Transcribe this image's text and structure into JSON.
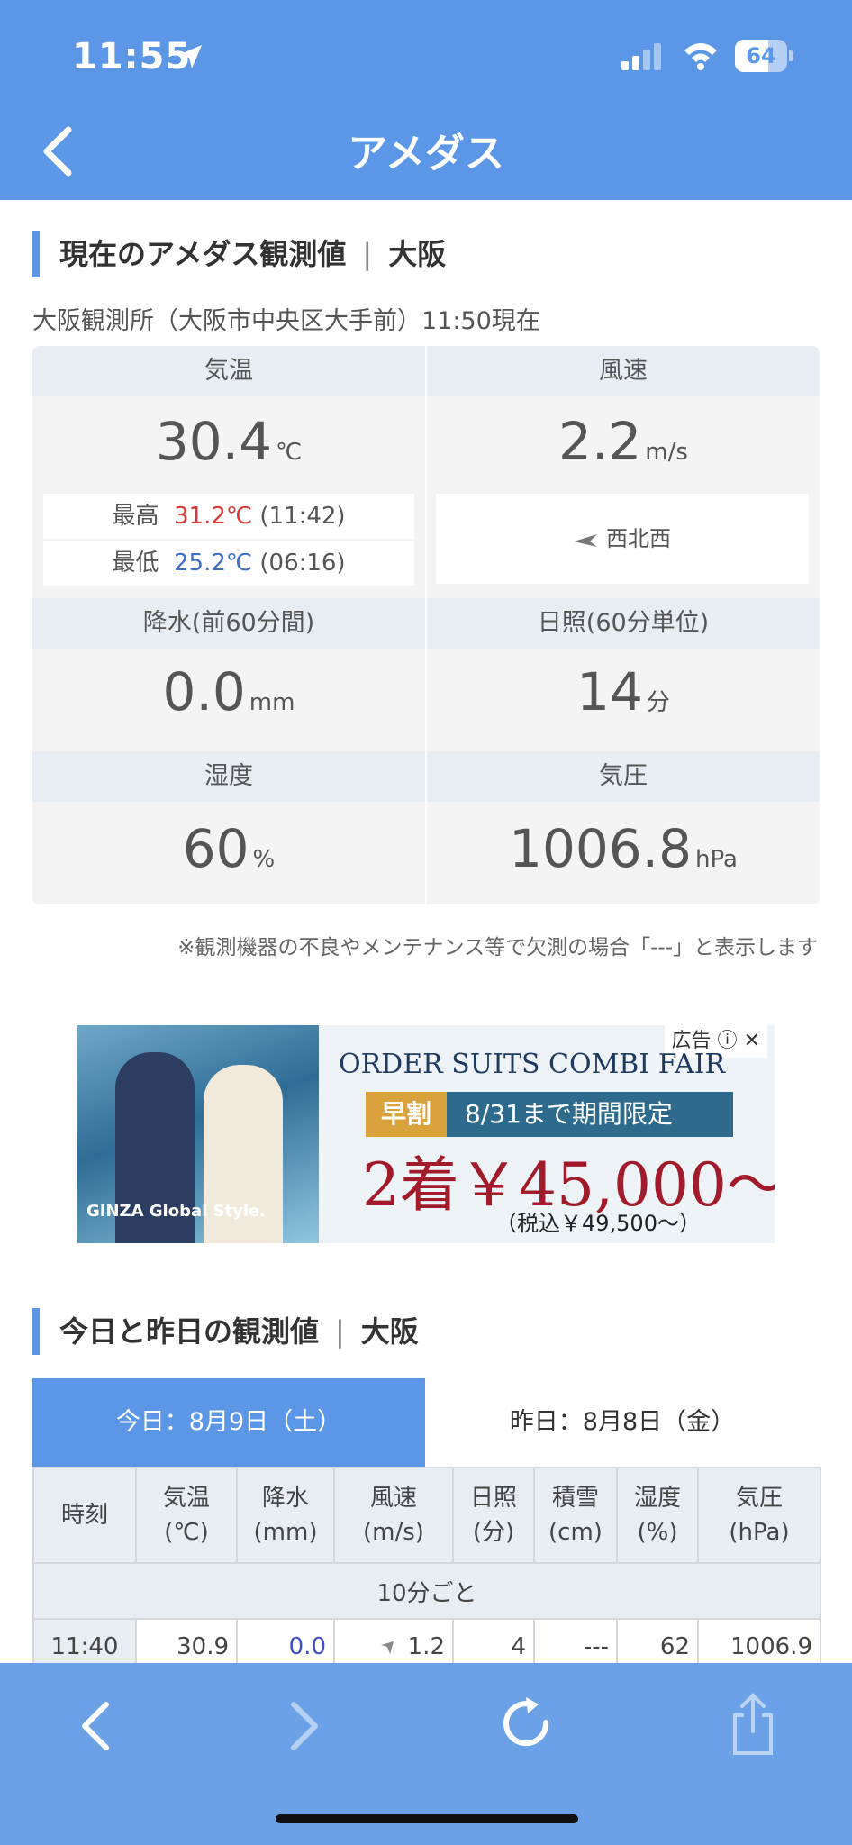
{
  "status_bar": {
    "time": "11:55",
    "battery": "64",
    "battery_level": 0.64
  },
  "header": {
    "title": "アメダス"
  },
  "current": {
    "heading": "現在のアメダス観測値",
    "heading_sep": "|",
    "heading_location": "大阪",
    "station": "大阪観測所（大阪市中央区大手前）11:50現在",
    "temperature": {
      "label": "気温",
      "value": "30.4",
      "unit": "℃",
      "max_label": "最高",
      "max_value": "31.2℃",
      "max_time": "(11:42)",
      "min_label": "最低",
      "min_value": "25.2℃",
      "min_time": "(06:16)"
    },
    "wind": {
      "label": "風速",
      "value": "2.2",
      "unit": "m/s",
      "direction": "西北西"
    },
    "precip": {
      "label": "降水(前60分間)",
      "value": "0.0",
      "unit": "mm"
    },
    "sunshine": {
      "label": "日照(60分単位)",
      "value": "14",
      "unit": "分"
    },
    "humidity": {
      "label": "湿度",
      "value": "60",
      "unit": "%"
    },
    "pressure": {
      "label": "気圧",
      "value": "1006.8",
      "unit": "hPa"
    },
    "note": "※観測機器の不良やメンテナンス等で欠測の場合「---」と表示します"
  },
  "ad": {
    "tag": "広告",
    "line1": "ORDER SUITS COMBI FAIR",
    "early": "早割",
    "limit": "8/31まで期間限定",
    "price": "2着￥45,000～",
    "tax": "（税込￥49,500～）",
    "brand": "GINZA Global Style."
  },
  "history": {
    "heading": "今日と昨日の観測値",
    "heading_sep": "|",
    "heading_location": "大阪",
    "tabs": [
      {
        "label": "今日：8月9日（土）",
        "active": true
      },
      {
        "label": "昨日：8月8日（金）",
        "active": false
      }
    ],
    "columns": [
      {
        "name": "時刻",
        "unit": ""
      },
      {
        "name": "気温",
        "unit": "(℃)"
      },
      {
        "name": "降水",
        "unit": "(mm)"
      },
      {
        "name": "風速",
        "unit": "(m/s)"
      },
      {
        "name": "日照",
        "unit": "(分)"
      },
      {
        "name": "積雪",
        "unit": "(cm)"
      },
      {
        "name": "湿度",
        "unit": "(%)"
      },
      {
        "name": "気圧",
        "unit": "(hPa)"
      }
    ],
    "interval_label": "10分ごと",
    "rows": [
      {
        "time": "11:40",
        "temp": "30.9",
        "precip": "0.0",
        "wind": "1.2",
        "sun": "4",
        "snow": "---",
        "humidity": "62",
        "pressure": "1006.9"
      }
    ]
  },
  "toolbar": {
    "back_icon": "chevron-left-icon",
    "forward_icon": "chevron-right-icon",
    "reload_icon": "reload-icon",
    "share_icon": "share-icon"
  },
  "colors": {
    "accent": "#5b97e6",
    "toolbar": "#6ba1e6",
    "max": "#d63b3b",
    "min": "#3f6fc4"
  }
}
